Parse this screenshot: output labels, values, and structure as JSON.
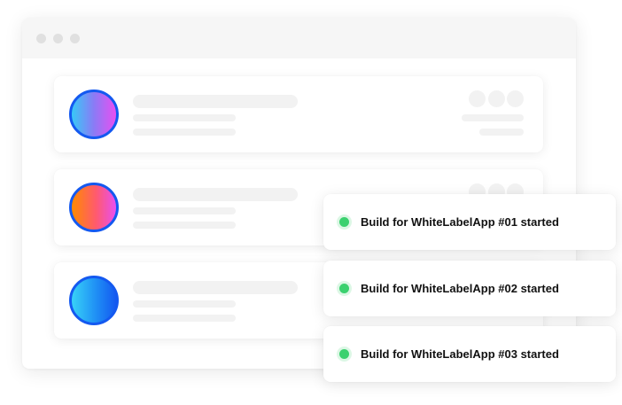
{
  "window": {
    "traffic_lights": [
      "close",
      "minimize",
      "maximize"
    ]
  },
  "project_list": {
    "items": [
      {
        "avatar": "gradient-avatar-cyan-magenta",
        "colors": [
          "#38c9f7",
          "#e94ff2"
        ]
      },
      {
        "avatar": "gradient-avatar-orange-pink",
        "colors": [
          "#ff8a00",
          "#e94ff2"
        ]
      },
      {
        "avatar": "gradient-avatar-cyan-blue",
        "colors": [
          "#38d2f7",
          "#1459f0"
        ]
      }
    ]
  },
  "notifications": [
    {
      "text": "Build for WhiteLabelApp #01 started",
      "status": "running",
      "status_color": "#3bd16f"
    },
    {
      "text": "Build for WhiteLabelApp #02 started",
      "status": "running",
      "status_color": "#3bd16f"
    },
    {
      "text": "Build for WhiteLabelApp #03 started",
      "status": "running",
      "status_color": "#3bd16f"
    }
  ],
  "colors": {
    "avatar_ring": "#1459f0",
    "placeholder": "#f2f2f2",
    "titlebar": "#f6f6f6"
  }
}
